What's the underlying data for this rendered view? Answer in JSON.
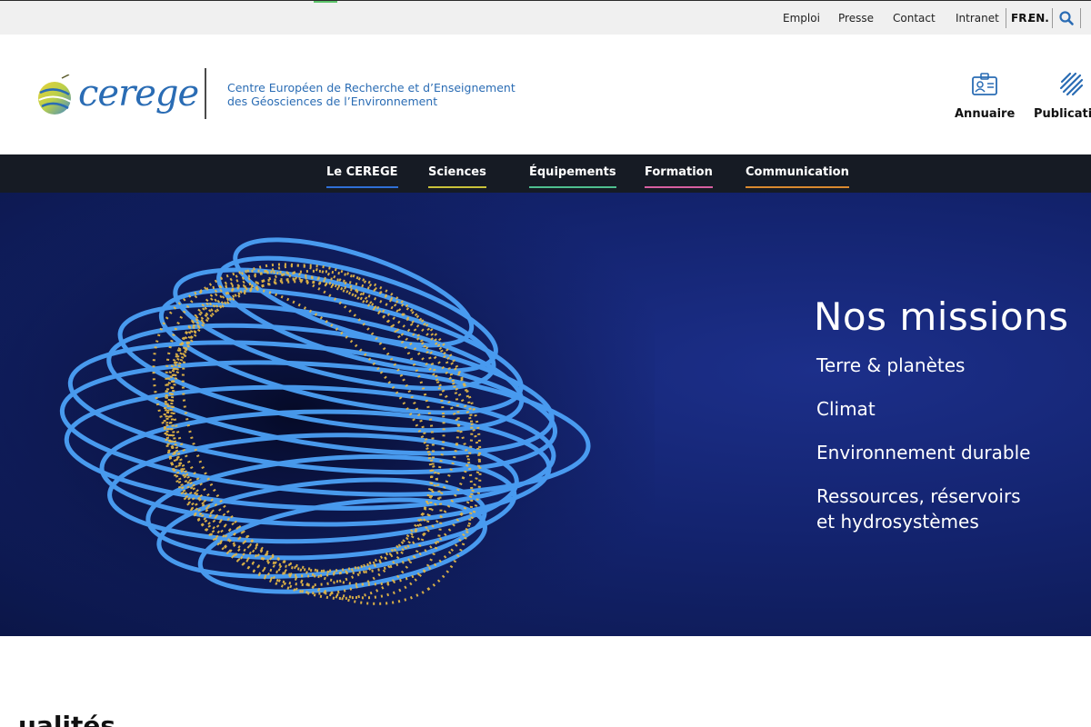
{
  "utility_bar": {
    "links": [
      {
        "label": "Emploi"
      },
      {
        "label": "Presse"
      },
      {
        "label": "Contact"
      },
      {
        "label": "Intranet"
      }
    ],
    "languages": [
      "FR.",
      "EN."
    ],
    "search_icon": "search-icon"
  },
  "header": {
    "logo_text": "cerege",
    "tagline_line1": "Centre Européen de Recherche et d’Enseignement",
    "tagline_line2": "des Géosciences de l’Environnement",
    "tools": [
      {
        "label": "Annuaire",
        "icon": "id-card-icon"
      },
      {
        "label": "Publicatio",
        "icon": "globe-lines-icon"
      }
    ]
  },
  "main_nav": {
    "items": [
      {
        "label": "Le CEREGE",
        "accent": "#2f6fd6"
      },
      {
        "label": "Sciences",
        "accent": "#c9c23a"
      },
      {
        "label": "Équipements",
        "accent": "#4fbf8f"
      },
      {
        "label": "Formation",
        "accent": "#d65fa0"
      },
      {
        "label": "Communication",
        "accent": "#d9892f"
      }
    ]
  },
  "hero": {
    "title": "Nos missions",
    "missions": [
      {
        "line1": "Terre & planètes"
      },
      {
        "line1": "Climat"
      },
      {
        "line1": "Environnement durable"
      },
      {
        "line1": "Ressources, réservoirs",
        "line2": "et hydrosystèmes"
      }
    ]
  },
  "next_section": {
    "heading": "ualités"
  },
  "colors": {
    "brand_blue": "#2a6cb4",
    "nav_background": "#161b24",
    "hero_background": "#13236e"
  }
}
